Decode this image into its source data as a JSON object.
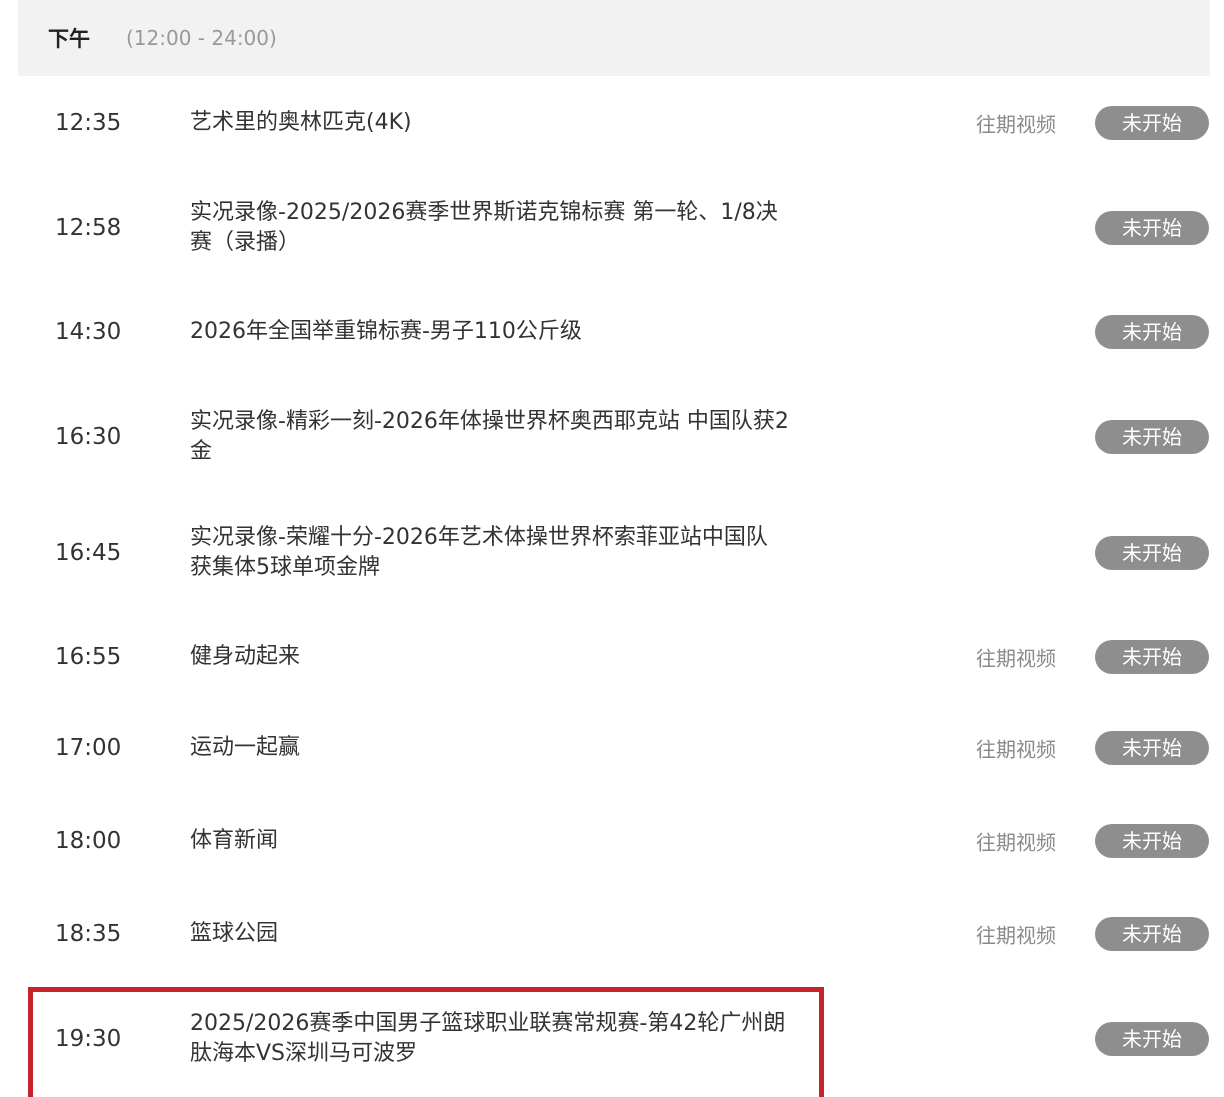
{
  "header": {
    "period": "下午",
    "range": "(12:00 - 24:00)"
  },
  "programs": [
    {
      "time": "12:35",
      "title": "艺术里的奥林匹克(4K)",
      "replay": "往期视频",
      "status": "未开始"
    },
    {
      "time": "12:58",
      "title": "实况录像-2025/2026赛季世界斯诺克锦标赛 第一轮、1/8决赛（录播）",
      "replay": "",
      "status": "未开始"
    },
    {
      "time": "14:30",
      "title": "2026年全国举重锦标赛-男子110公斤级",
      "replay": "",
      "status": "未开始"
    },
    {
      "time": "16:30",
      "title": "实况录像-精彩一刻-2026年体操世界杯奥西耶克站 中国队获2金",
      "replay": "",
      "status": "未开始"
    },
    {
      "time": "16:45",
      "title": "实况录像-荣耀十分-2026年艺术体操世界杯索菲亚站中国队获集体5球单项金牌",
      "replay": "",
      "status": "未开始"
    },
    {
      "time": "16:55",
      "title": "健身动起来",
      "replay": "往期视频",
      "status": "未开始"
    },
    {
      "time": "17:00",
      "title": "运动一起赢",
      "replay": "往期视频",
      "status": "未开始"
    },
    {
      "time": "18:00",
      "title": "体育新闻",
      "replay": "往期视频",
      "status": "未开始"
    },
    {
      "time": "18:35",
      "title": "篮球公园",
      "replay": "往期视频",
      "status": "未开始"
    },
    {
      "time": "19:30",
      "title": "2025/2026赛季中国男子篮球职业联赛常规赛-第42轮广州朗肽海本VS深圳马可波罗",
      "replay": "",
      "status": "未开始"
    }
  ],
  "colors": {
    "status_bg": "#8e8e8e",
    "highlight_border": "#c5252a",
    "header_bg": "#f2f2f2"
  }
}
